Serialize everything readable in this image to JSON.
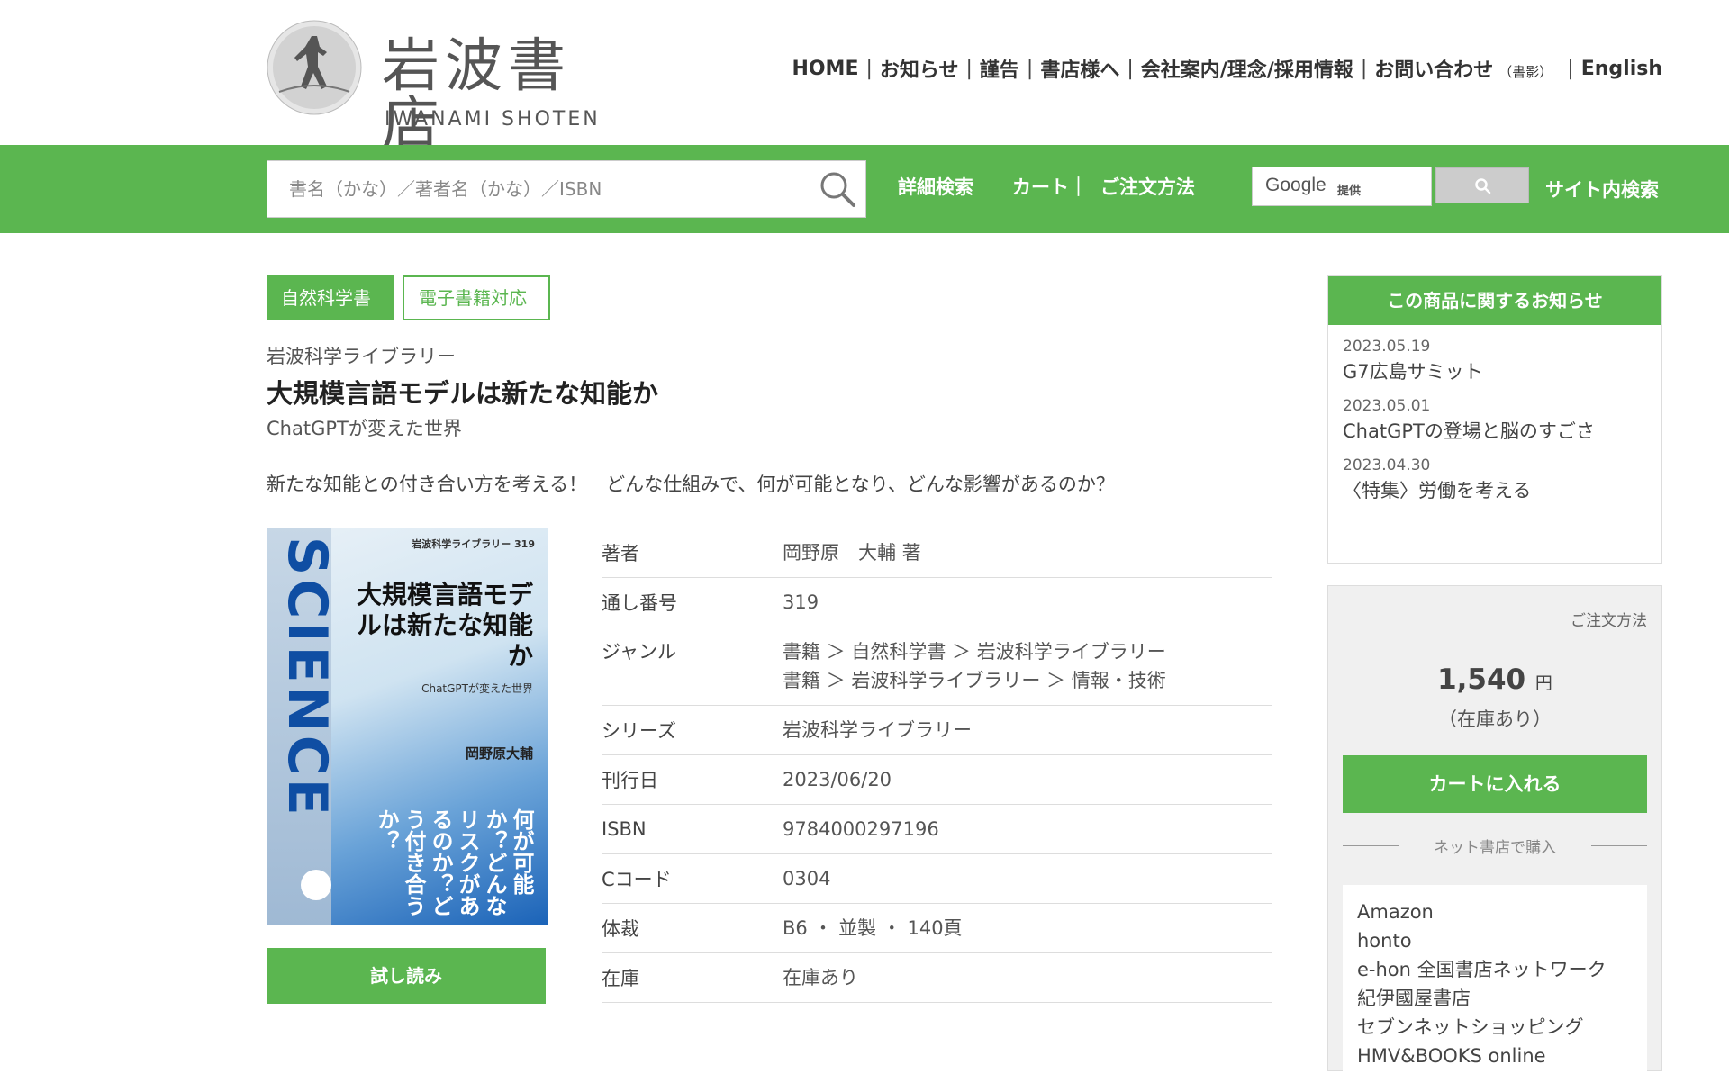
{
  "logo": {
    "jp": "岩波書店",
    "en": "IWANAMI  SHOTEN"
  },
  "topnav": [
    {
      "label": "HOME"
    },
    {
      "label": "お知らせ"
    },
    {
      "label": "謹告"
    },
    {
      "label": "書店様へ"
    },
    {
      "label": "会社案内/理念/採用情報"
    },
    {
      "label": "お問い合わせ",
      "small": "（書影）"
    },
    {
      "label": "English"
    }
  ],
  "search": {
    "placeholder": "書名（かな）／著者名（かな）／ISBN"
  },
  "greennav": {
    "advanced": "詳細検索",
    "cart": "カート｜",
    "order": "ご注文方法",
    "google_logo": "Google",
    "google_sub": "提供",
    "site_search": "サイト内検索"
  },
  "tags": {
    "genre": "自然科学書",
    "ebook": "電子書籍対応"
  },
  "book": {
    "series_label": "岩波科学ライブラリー",
    "title": "大規模言語モデルは新たな知能か",
    "subtitle": "ChatGPTが変えた世界",
    "lead": "新たな知能との付き合い方を考える！　どんな仕組みで、何が可能となり、どんな影響があるのか？",
    "cover": {
      "science": "SCIENCE",
      "series": "岩波科学ライブラリー 319",
      "title": "大規模言語モデルは新たな知能か",
      "sub": "ChatGPTが変えた世界",
      "author": "岡野原大輔",
      "vertical": "何が可能か？どんなリスクがあるのか？どう付き合うか？"
    },
    "trial_label": "試し読み"
  },
  "details": [
    {
      "label": "著者",
      "value": "岡野原　大輔 著"
    },
    {
      "label": "通し番号",
      "value": "319"
    },
    {
      "label": "ジャンル",
      "value": "書籍 ＞ 自然科学書 ＞ 岩波科学ライブラリー",
      "value2": "書籍 ＞ 岩波科学ライブラリー ＞ 情報・技術"
    },
    {
      "label": "シリーズ",
      "value": "岩波科学ライブラリー"
    },
    {
      "label": "刊行日",
      "value": "2023/06/20"
    },
    {
      "label": "ISBN",
      "value": "9784000297196"
    },
    {
      "label": "Cコード",
      "value": "0304"
    },
    {
      "label": "体裁",
      "value": "B6 ・ 並製 ・ 140頁"
    },
    {
      "label": "在庫",
      "value": "在庫あり"
    }
  ],
  "news": {
    "heading": "この商品に関するお知らせ",
    "items": [
      {
        "date": "2023.05.19",
        "text": "G7広島サミット"
      },
      {
        "date": "2023.05.01",
        "text": "ChatGPTの登場と脳のすごさ"
      },
      {
        "date": "2023.04.30",
        "text": "〈特集〉労働を考える"
      }
    ]
  },
  "buy": {
    "how": "ご注文方法",
    "price": "1,540",
    "yen": "円",
    "stock": "（在庫あり）",
    "cart_label": "カートに入れる",
    "net_label": "ネット書店で購入",
    "stores": [
      "Amazon",
      "honto",
      "e-hon 全国書店ネットワーク",
      "紀伊國屋書店",
      "セブンネットショッピング",
      "HMV&BOOKS online"
    ]
  }
}
